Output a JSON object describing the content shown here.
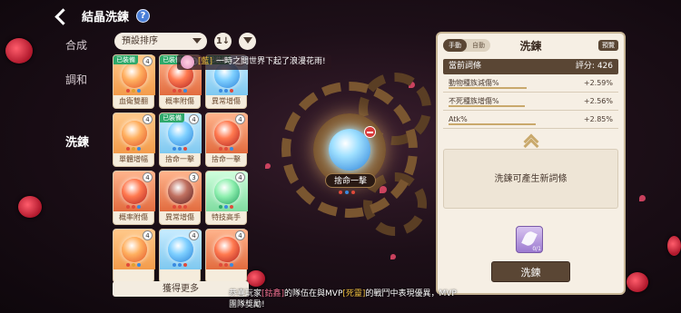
{
  "header": {
    "title": "結晶洗鍊",
    "help_label": "?"
  },
  "sidenav": {
    "items": [
      "合成",
      "調和",
      "洗鍊"
    ],
    "active": "洗鍊"
  },
  "sortbar": {
    "sort_value": "預設排序",
    "order_label": "1↓"
  },
  "crystals": [
    {
      "name": "血衛雙翻",
      "equipped": true,
      "level": "4",
      "color": "orange"
    },
    {
      "name": "概率附傷",
      "equipped": true,
      "level": "4",
      "color": "red"
    },
    {
      "name": "異常增傷",
      "equipped": true,
      "level": "4",
      "color": "blue"
    },
    {
      "name": "單體增幅",
      "equipped": false,
      "level": "4",
      "color": "orange"
    },
    {
      "name": "捨命一擊",
      "equipped": true,
      "level": "4",
      "color": "blue"
    },
    {
      "name": "捨命一擊",
      "equipped": false,
      "level": "4",
      "color": "red"
    },
    {
      "name": "概率附傷",
      "equipped": false,
      "level": "4",
      "color": "red"
    },
    {
      "name": "異常增傷",
      "equipped": false,
      "level": "3",
      "color": "dark"
    },
    {
      "name": "特技高手",
      "equipped": false,
      "level": "4",
      "color": "green"
    },
    {
      "name": "",
      "equipped": false,
      "level": "4",
      "color": "orange"
    },
    {
      "name": "",
      "equipped": false,
      "level": "4",
      "color": "blue"
    },
    {
      "name": "",
      "equipped": false,
      "level": "4",
      "color": "red"
    }
  ],
  "equipped_badge": "已裝備",
  "more_button": "獲得更多",
  "broadcast": {
    "user": "[藍]",
    "text": "一時之間世界下起了浪漫花雨!"
  },
  "center": {
    "label": "捨命一擊"
  },
  "panel": {
    "mode_manual": "手動",
    "mode_auto": "自動",
    "title": "洗鍊",
    "preview": "預覽",
    "current_affix_label": "當前詞條",
    "score_label": "評分: 426",
    "affixes": [
      {
        "name": "動物種族減傷%",
        "value": "+2.59%",
        "fill": 0.72
      },
      {
        "name": "不死種族增傷%",
        "value": "+2.56%",
        "fill": 0.7
      },
      {
        "name": "Atk%",
        "value": "+2.85%",
        "fill": 0.8
      }
    ],
    "new_affix_text": "洗鍊可產生新詞條",
    "material_count": "0/1",
    "refine_button": "洗鍊"
  },
  "notice": {
    "prefix": "恭喜玩家",
    "player": "[鈷鑫]",
    "mid": "的隊伍在與MVP",
    "boss": "[死靈]",
    "suffix": "的戰鬥中表現優異，MVP",
    "line2": "團隊獎勵!"
  },
  "colors": {
    "panel_dark": "#5a4634",
    "equipped_green": "#2ea96a",
    "gold": "#f0c040"
  }
}
